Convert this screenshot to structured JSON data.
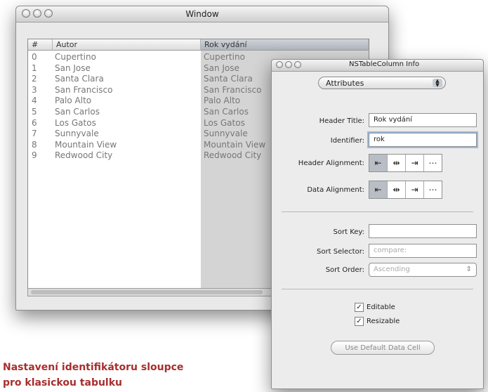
{
  "main_window": {
    "title": "Window",
    "columns": [
      "#",
      "Autor",
      "Rok vydání"
    ],
    "rows": [
      [
        "0",
        "Cupertino",
        "Cupertino"
      ],
      [
        "1",
        "San Jose",
        "San Jose"
      ],
      [
        "2",
        "Santa Clara",
        "Santa Clara"
      ],
      [
        "3",
        "San Francisco",
        "San Francisco"
      ],
      [
        "4",
        "Palo Alto",
        "Palo Alto"
      ],
      [
        "5",
        "San Carlos",
        "San Carlos"
      ],
      [
        "6",
        "Los Gatos",
        "Los Gatos"
      ],
      [
        "7",
        "Sunnyvale",
        "Sunnyvale"
      ],
      [
        "8",
        "Mountain View",
        "Mountain View"
      ],
      [
        "9",
        "Redwood City",
        "Redwood City"
      ]
    ]
  },
  "inspector": {
    "title": "NSTableColumn Info",
    "popup": "Attributes",
    "header_title_label": "Header Title:",
    "header_title_value": "Rok vydání",
    "identifier_label": "Identifier:",
    "identifier_value": "rok",
    "header_alignment_label": "Header Alignment:",
    "data_alignment_label": "Data Alignment:",
    "sort_key_label": "Sort Key:",
    "sort_key_value": "",
    "sort_selector_label": "Sort Selector:",
    "sort_selector_value": "compare:",
    "sort_order_label": "Sort Order:",
    "sort_order_value": "Ascending",
    "editable_label": "Editable",
    "resizable_label": "Resizable",
    "default_cell_button": "Use Default Data Cell"
  },
  "caption": {
    "line1": "Nastavení identifikátoru sloupce",
    "line2": "pro klasickou tabulku"
  }
}
